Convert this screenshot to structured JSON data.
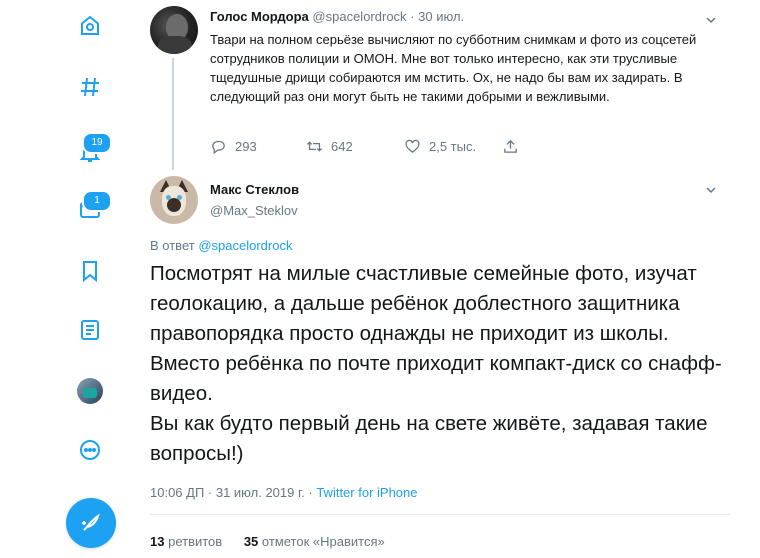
{
  "nav": {
    "notifications_badge": "19",
    "messages_badge": "1"
  },
  "parent_tweet": {
    "name": "Голос Мордора",
    "handle": "@spacelordrock",
    "separator": "·",
    "date": "30 июл.",
    "text": "Твари на полном серьёзе вычисляют по субботним снимкам и фото из соцсетей сотрудников полиции и ОМОН. Мне вот только интересно, как эти трусливые тщедушные дрищи собираются им мстить. Ох, не надо бы вам их задирать. В следующий раз они могут быть не такими добрыми и вежливыми.",
    "replies": "293",
    "retweets": "642",
    "likes": "2,5 тыс."
  },
  "main_tweet": {
    "name": "Макс Стеклов",
    "handle": "@Max_Steklov",
    "reply_prefix": "В ответ",
    "reply_to": "@spacelordrock",
    "text": "Посмотрят на милые счастливые семейные фото, изучат геолокацию, а дальше ребёнок доблестного защитника правопорядка просто однажды не приходит из школы. Вместо ребёнка по почте приходит компакт-диск со снафф-видео.\nВы как будто первый день на свете живёте, задавая такие вопросы!)",
    "time": "10:06 ДП · 31 июл. 2019 г. ·",
    "source": "Twitter for iPhone",
    "retweets_count": "13",
    "retweets_label": "ретвитов",
    "likes_count": "35",
    "likes_label": "отметок «Нравится»"
  },
  "colors": {
    "accent": "#1da1f2",
    "text_primary": "#14171a",
    "text_secondary": "#657786",
    "divider": "#e6ecf0"
  },
  "icons": [
    "hashtag-icon",
    "bell-icon",
    "mail-icon",
    "bookmark-icon",
    "list-icon",
    "more-circle-icon",
    "compose-icon",
    "reply-icon",
    "retweet-icon",
    "like-icon",
    "share-icon",
    "chevron-down-icon"
  ]
}
